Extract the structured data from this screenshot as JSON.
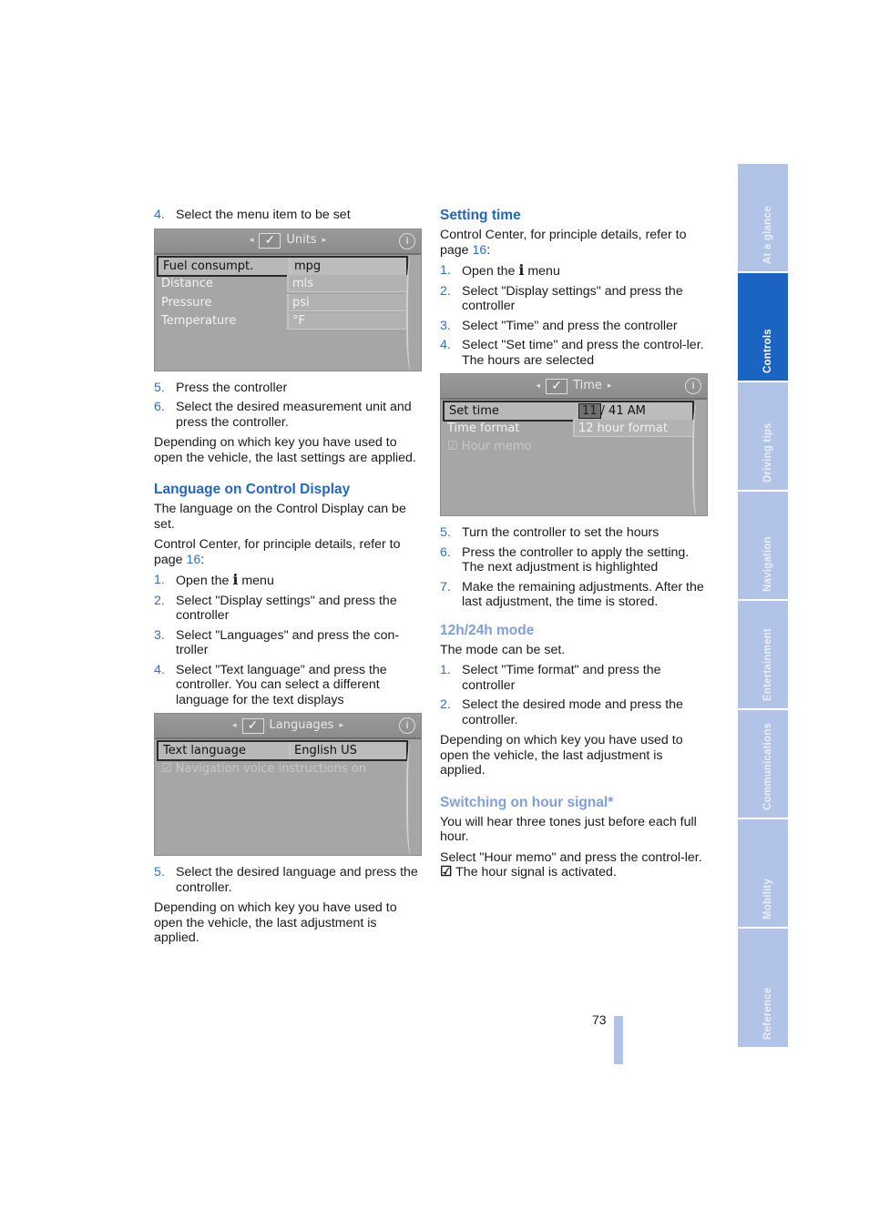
{
  "left_column": {
    "intro_step": {
      "num": "4.",
      "text": "Select the menu item to be set"
    },
    "units_screen": {
      "title": "Units",
      "rows": [
        {
          "label": "Fuel consumpt.",
          "value": "mpg",
          "selected": true
        },
        {
          "label": "Distance",
          "value": "mls"
        },
        {
          "label": "Pressure",
          "value": "psi"
        },
        {
          "label": "Temperature",
          "value": "°F"
        }
      ]
    },
    "steps_after_units": [
      {
        "num": "5.",
        "text": "Press the controller"
      },
      {
        "num": "6.",
        "text": "Select the desired measurement unit and press the controller."
      }
    ],
    "units_note": "Depending on which key you have used to open the vehicle, the last settings are applied.",
    "language_section": {
      "heading": "Language on Control Display",
      "intro": "The language on the Control Display can be set.",
      "ref_prefix": "Control Center, for principle details, refer to page ",
      "ref_page": "16",
      "ref_suffix": ":",
      "steps": [
        {
          "num": "1.",
          "pre": "Open the ",
          "icon": "i",
          "post": " menu"
        },
        {
          "num": "2.",
          "text": "Select \"Display settings\" and press the controller"
        },
        {
          "num": "3.",
          "text": "Select \"Languages\" and press the con-troller"
        },
        {
          "num": "4.",
          "text": "Select \"Text language\" and press the controller. You can select a different language for the text displays"
        }
      ],
      "screen": {
        "title": "Languages",
        "rows": [
          {
            "label": "Text language",
            "value": "English US",
            "selected": true
          }
        ],
        "option": "Navigation voice instructions on"
      },
      "final_step": {
        "num": "5.",
        "text": "Select the desired language and press the controller."
      },
      "note": "Depending on which key you have used to open the vehicle, the last adjustment is applied."
    }
  },
  "right_column": {
    "setting_time": {
      "heading": "Setting time",
      "ref_prefix": "Control Center, for principle details, refer to page ",
      "ref_page": "16",
      "ref_suffix": ":",
      "steps": [
        {
          "num": "1.",
          "pre": "Open the ",
          "icon": "i",
          "post": " menu"
        },
        {
          "num": "2.",
          "text": "Select \"Display settings\" and press the controller"
        },
        {
          "num": "3.",
          "text": "Select \"Time\" and press the controller"
        },
        {
          "num": "4.",
          "text": "Select \"Set time\" and press the control-ler. The hours are selected"
        }
      ],
      "screen": {
        "title": "Time",
        "set_time_label": "Set time",
        "hours": "11",
        "rest": "/ 41 AM",
        "format_label": "Time format",
        "format_value": "12 hour format",
        "option": "Hour memo"
      },
      "steps_after": [
        {
          "num": "5.",
          "text": "Turn the controller to set the hours"
        },
        {
          "num": "6.",
          "text": "Press the controller to apply the setting. The next adjustment is highlighted"
        },
        {
          "num": "7.",
          "text": "Make the remaining adjustments. After the last adjustment, the time is stored."
        }
      ]
    },
    "mode_section": {
      "heading": "12h/24h mode",
      "intro": "The mode can be set.",
      "steps": [
        {
          "num": "1.",
          "text": "Select \"Time format\" and press the controller"
        },
        {
          "num": "2.",
          "text": "Select the desired mode and press the controller."
        }
      ],
      "note": "Depending on which key you have used to open the vehicle, the last adjustment is applied."
    },
    "hour_signal": {
      "heading": "Switching on hour signal*",
      "intro": "You will hear three tones just before each full hour.",
      "instruction": "Select \"Hour memo\" and press the control-ler.",
      "result": "The hour signal is activated."
    }
  },
  "side_tabs": [
    {
      "label": "At a glance",
      "active": false
    },
    {
      "label": "Controls",
      "active": true
    },
    {
      "label": "Driving tips",
      "active": false
    },
    {
      "label": "Navigation",
      "active": false
    },
    {
      "label": "Entertainment",
      "active": false
    },
    {
      "label": "Communications",
      "active": false
    },
    {
      "label": "Mobility",
      "active": false
    },
    {
      "label": "Reference",
      "active": false
    }
  ],
  "page_number": "73",
  "colors": {
    "heading_dark": "#2266c0",
    "heading_light": "#7f9fdc",
    "tab_inactive": "#b2c3e8",
    "tab_active": "#1c64c2"
  }
}
